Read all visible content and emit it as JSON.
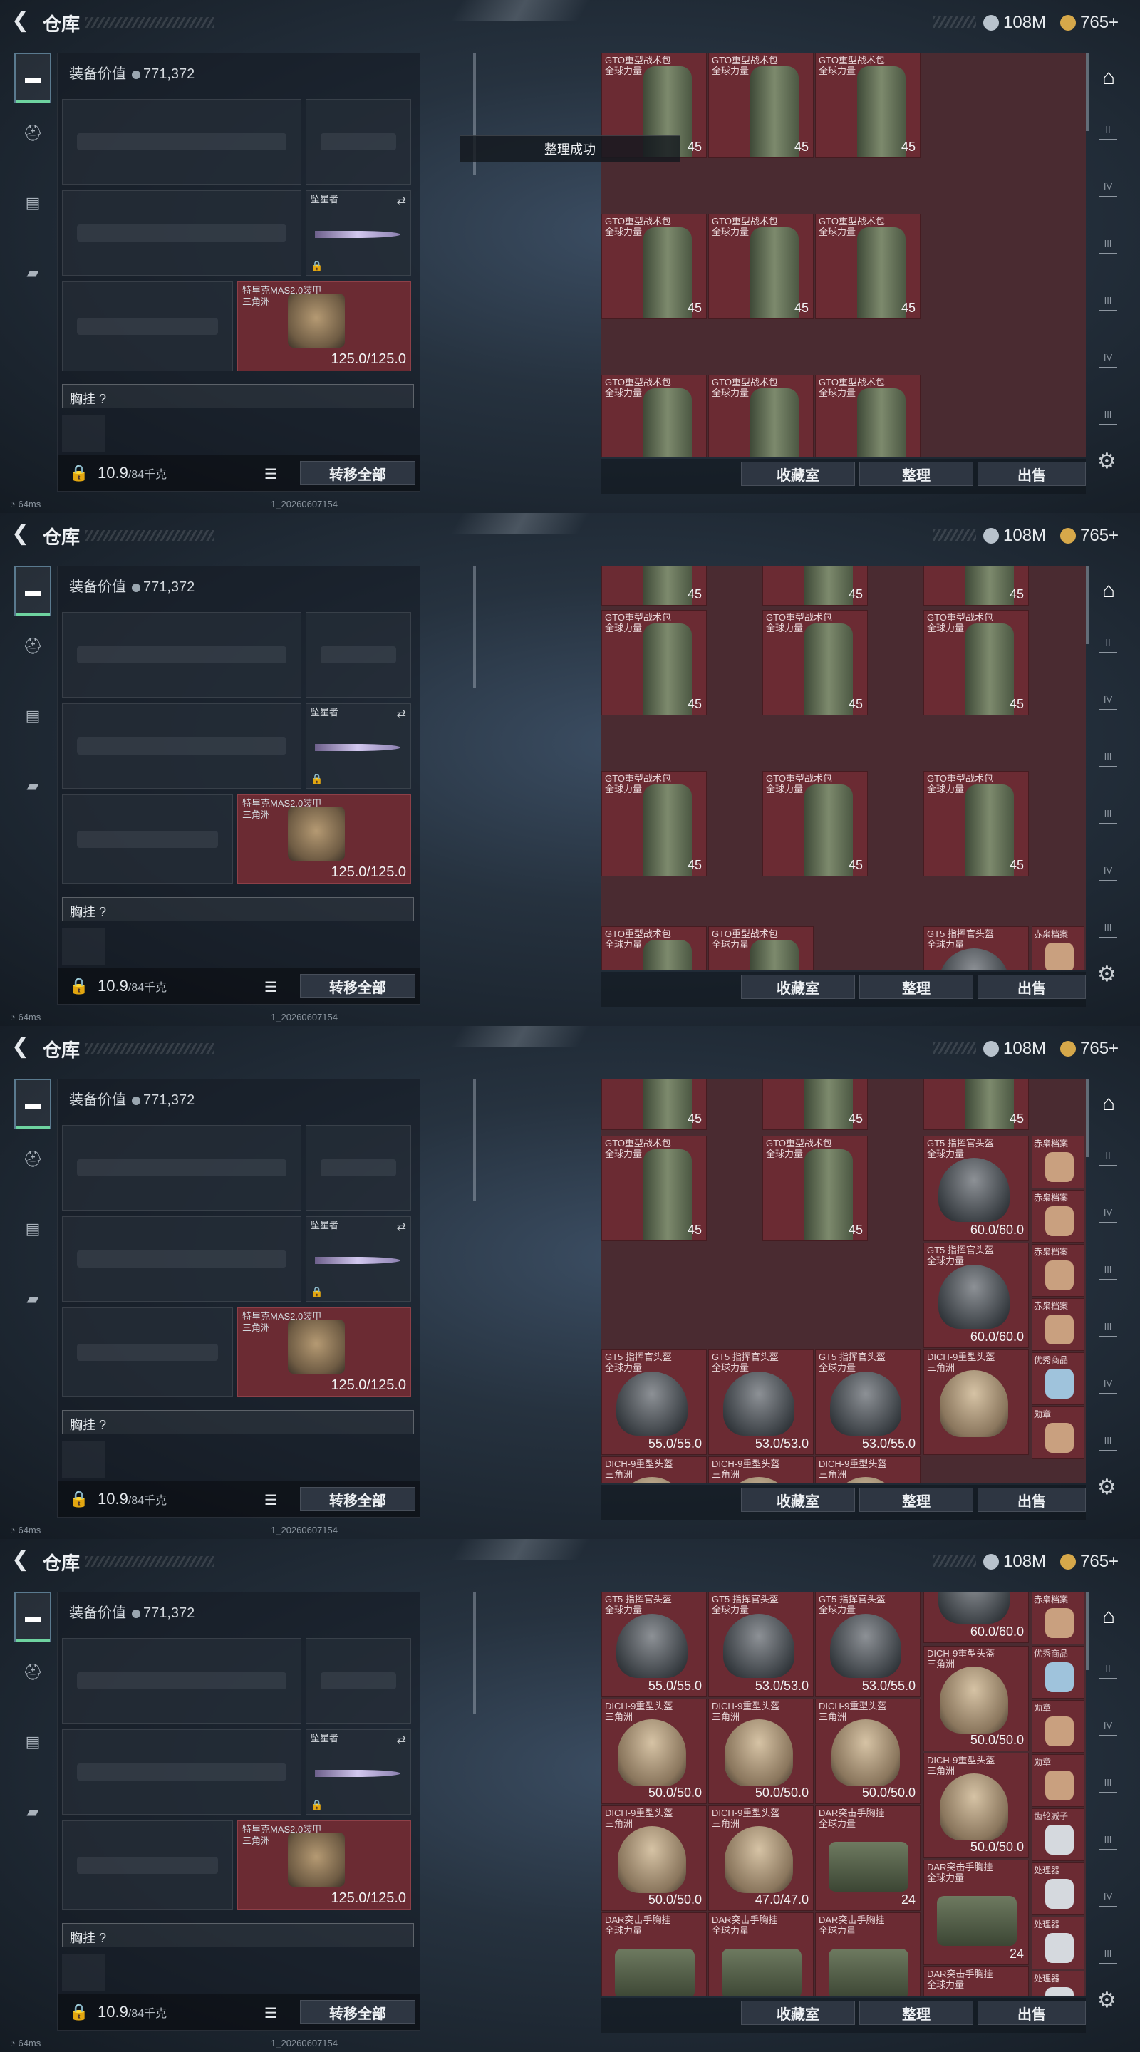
{
  "header": {
    "title": "仓库",
    "back_icon": "back-arrow-icon",
    "currency1": "108M",
    "currency2": "765+",
    "coin1_color": "#b8c2cc",
    "coin2_color": "#d6a84a"
  },
  "equip": {
    "value_label": "装备价值",
    "value": "771,372",
    "melee_name": "坠星者",
    "armor_name": "特里克MAS2.0装甲\n三角洲",
    "armor_durability": "125.0/125.0",
    "chest_label": "胸挂",
    "chest_help": "?",
    "weight": "10.9",
    "weight_max": "/84千克",
    "transfer_all": "转移全部"
  },
  "footer": {
    "favorites": "收藏室",
    "sort": "整理",
    "sell": "出售"
  },
  "status": {
    "ping": "64ms",
    "build": "1_20260607154"
  },
  "toast": "整理成功",
  "items": {
    "bag": "GTO重型战术包\n全球力量",
    "bag_count": "45",
    "gt5": "GT5 指挥官头盔\n全球力量",
    "gt5_a": "55.0/55.0",
    "gt5_b": "53.0/53.0",
    "gt5_c": "53.0/55.0",
    "gt5_d": "60.0/60.0",
    "dich": "DICH-9重型头盔\n三角洲",
    "dich_a": "50.0/50.0",
    "dich_b": "47.0/47.0",
    "dar": "DAR突击手胸挂\n全球力量",
    "dar_count": "24",
    "s_red": "赤枭档案",
    "s_best": "优秀商品",
    "s_medal": "勋章",
    "s_gear": "齿轮减子",
    "s_proc": "处理器"
  }
}
